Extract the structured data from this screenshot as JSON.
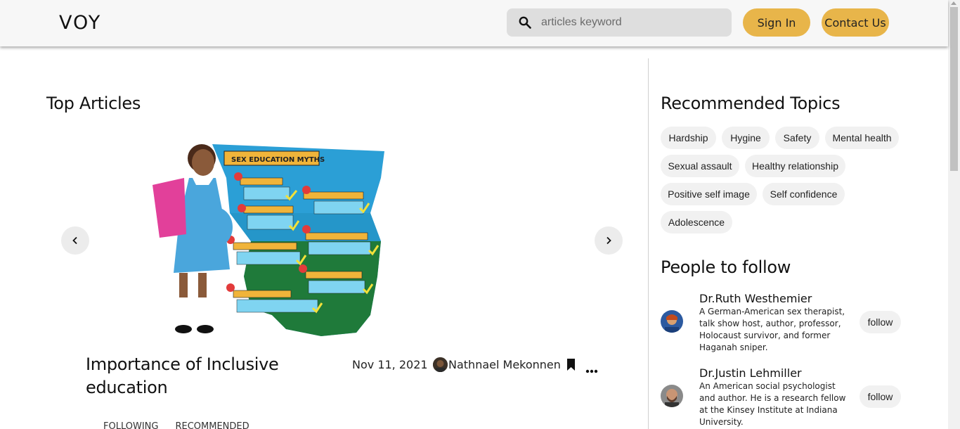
{
  "header": {
    "logo": "VOY",
    "search": {
      "placeholder": "articles keyword",
      "icon": "search-icon"
    },
    "sign_in_label": "Sign In",
    "contact_label": "Contact Us",
    "accent_color": "#e8b54a"
  },
  "main": {
    "section_title": "Top Articles",
    "featured_article": {
      "image_title": "SEX EDUCATION MYTHS",
      "title": "Importance of Inclusive education",
      "date": "Nov 11, 2021",
      "author": "Nathnael Mekonnen"
    },
    "feed_tabs": [
      "FOLLOWING",
      "RECOMMENDED"
    ]
  },
  "sidebar": {
    "topics_title": "Recommended Topics",
    "topics": [
      "Hardship",
      "Hygine",
      "Safety",
      "Mental health",
      "Sexual assault",
      "Healthy relationship",
      "Positive self image",
      "Self confidence",
      "Adolescence"
    ],
    "people_title": "People to follow",
    "people": [
      {
        "name": "Dr.Ruth Westhemier",
        "description": "A German-American sex therapist, talk show host, author, professor, Holocaust survivor, and former Haganah sniper.",
        "follow_label": "follow"
      },
      {
        "name": "Dr.Justin Lehmiller",
        "description": "An American social psychologist and author. He is a research fellow at the Kinsey Institute at Indiana University.",
        "follow_label": "follow"
      }
    ]
  }
}
